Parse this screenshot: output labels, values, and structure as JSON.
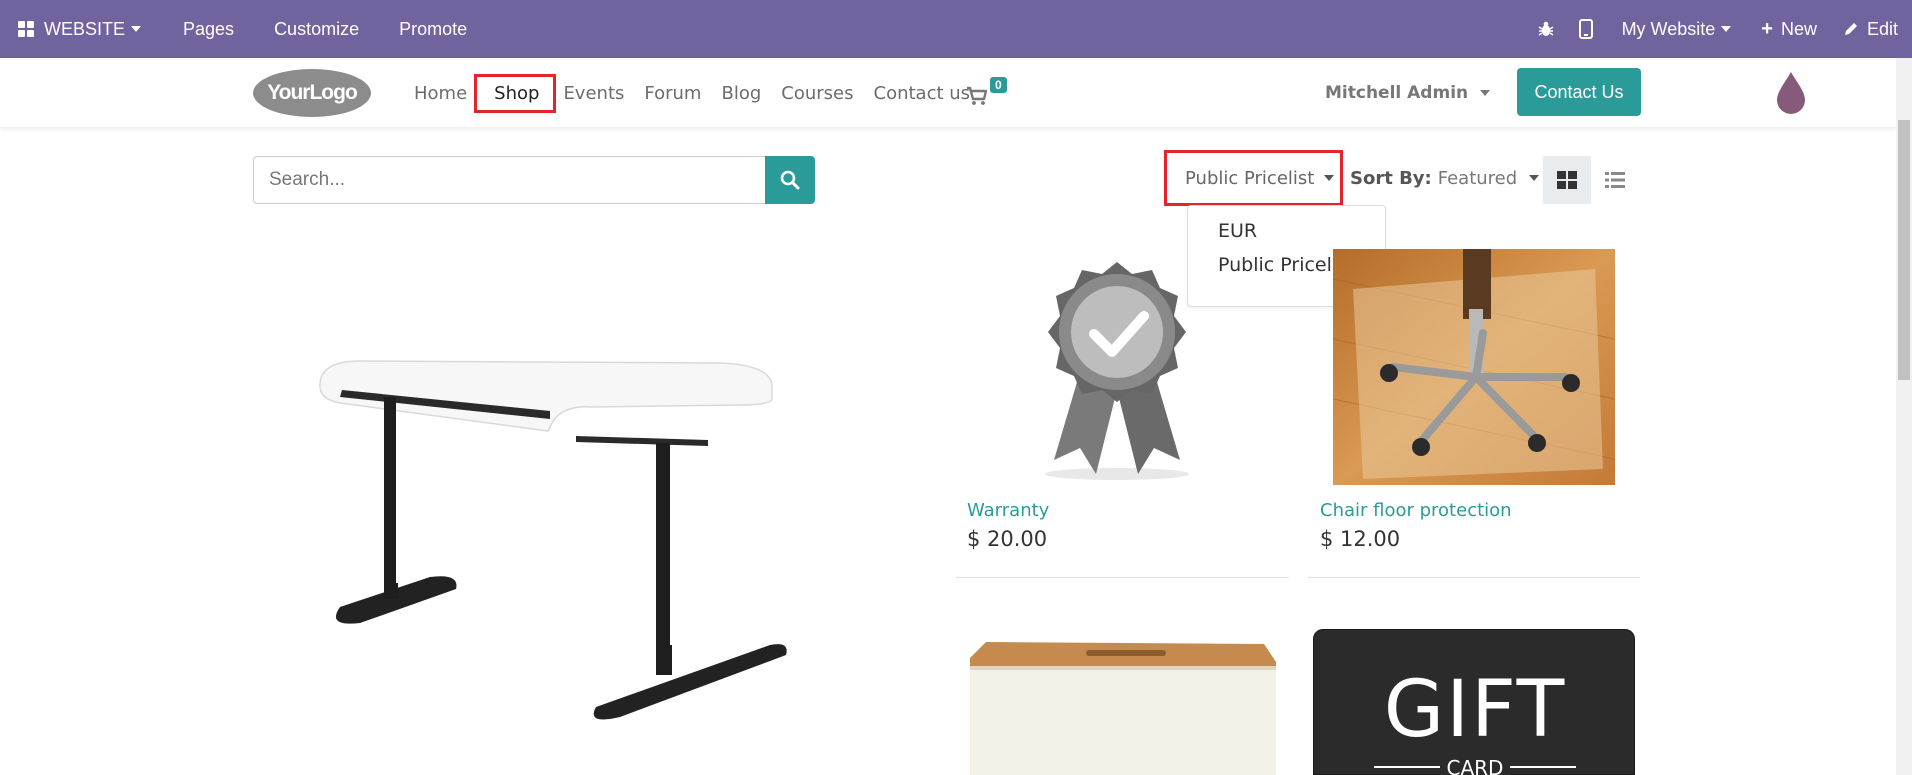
{
  "adminbar": {
    "website_label": "WEBSITE",
    "pages_label": "Pages",
    "customize_label": "Customize",
    "promote_label": "Promote",
    "my_website_label": "My Website",
    "new_label": "New",
    "edit_label": "Edit"
  },
  "header": {
    "logo_text": "YourLogo",
    "nav": [
      "Home",
      "Shop",
      "Events",
      "Forum",
      "Blog",
      "Courses",
      "Contact us"
    ],
    "active_nav": "Shop",
    "cart_count": "0",
    "user_name": "Mitchell Admin",
    "contact_button": "Contact Us"
  },
  "toolbar": {
    "search_placeholder": "Search...",
    "pricelist_label": "Public Pricelist",
    "sort_prefix": "Sort By:",
    "sort_value": "Featured"
  },
  "pricelist_dropdown": {
    "options": [
      "EUR",
      "Public Pricelist"
    ]
  },
  "products": [
    {
      "name": "Warranty",
      "price": "$ 20.00"
    },
    {
      "name": "Chair floor protection",
      "price": "$ 12.00"
    }
  ],
  "gift_card_text": {
    "big": "GIFT",
    "small": "CARD"
  },
  "colors": {
    "brand_purple": "#71639e",
    "accent_teal": "#2a9b99",
    "highlight_red": "#e3242b"
  }
}
